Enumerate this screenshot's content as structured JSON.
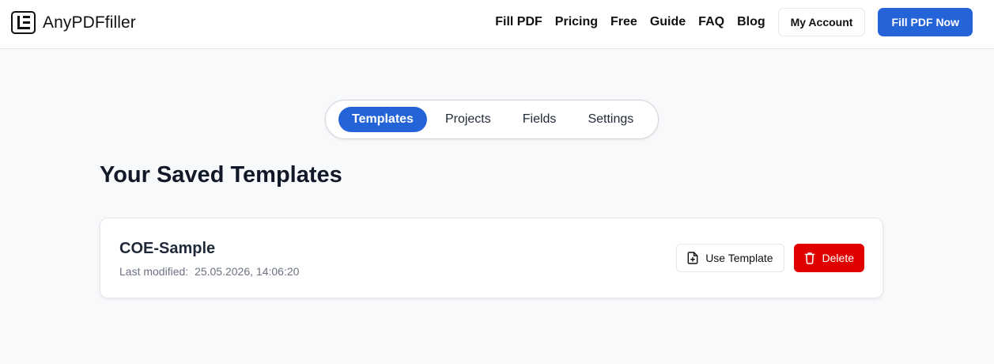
{
  "header": {
    "logo_text": "AnyPDFfiller",
    "nav": [
      {
        "label": "Fill PDF"
      },
      {
        "label": "Pricing"
      },
      {
        "label": "Free"
      },
      {
        "label": "Guide"
      },
      {
        "label": "FAQ"
      },
      {
        "label": "Blog"
      }
    ],
    "account_label": "My Account",
    "cta_label": "Fill PDF Now"
  },
  "tabs": [
    {
      "label": "Templates",
      "active": true
    },
    {
      "label": "Projects",
      "active": false
    },
    {
      "label": "Fields",
      "active": false
    },
    {
      "label": "Settings",
      "active": false
    }
  ],
  "main": {
    "title": "Your Saved Templates",
    "templates": [
      {
        "name": "COE-Sample",
        "modified_label": "Last modified:",
        "modified_value": "25.05.2026, 14:06:20",
        "use_label": "Use Template",
        "use_icon": "file-plus-icon",
        "delete_label": "Delete",
        "delete_icon": "trash-icon"
      }
    ]
  },
  "colors": {
    "accent": "#2563d8",
    "danger": "#e00000",
    "background": "#f8f9fb"
  }
}
